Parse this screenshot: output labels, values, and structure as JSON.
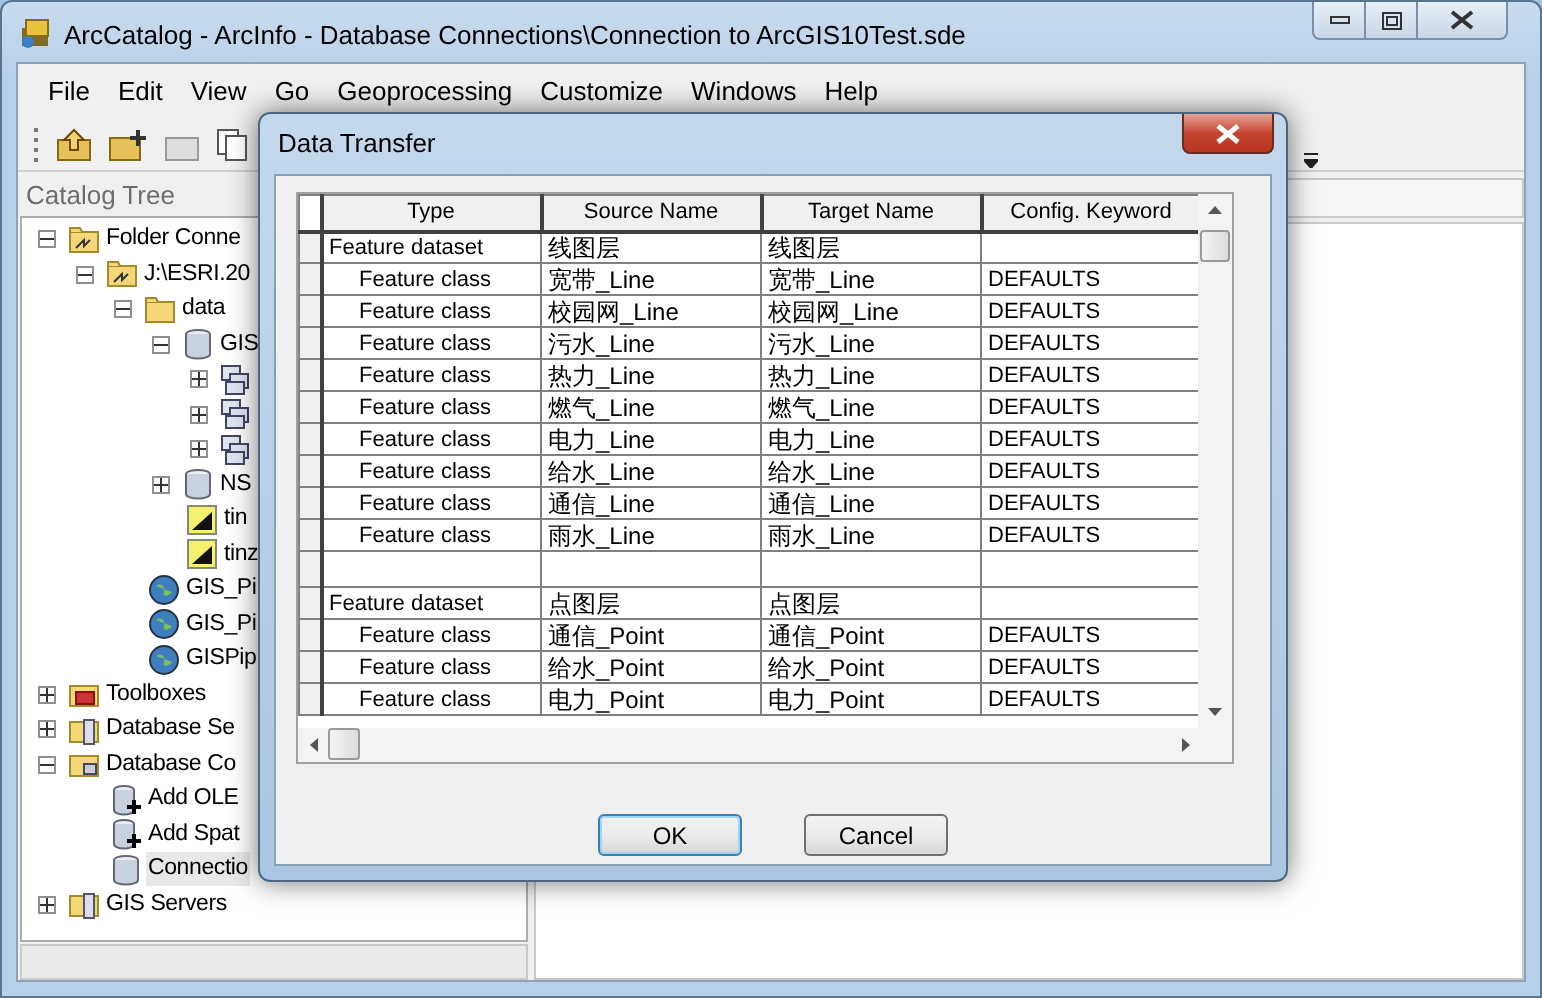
{
  "window": {
    "title": "ArcCatalog - ArcInfo - Database Connections\\Connection to ArcGIS10Test.sde"
  },
  "menu": [
    "File",
    "Edit",
    "View",
    "Go",
    "Geoprocessing",
    "Customize",
    "Windows",
    "Help"
  ],
  "catalog_tree": {
    "title": "Catalog Tree",
    "items": [
      {
        "label": "Folder Conne",
        "kind": "connection",
        "expanded": true,
        "selected": false,
        "children": [
          {
            "label": "J:\\ESRI.20",
            "kind": "connection",
            "expanded": true,
            "selected": false,
            "children": [
              {
                "label": "data",
                "kind": "folder",
                "expanded": true,
                "selected": false,
                "children": [
                  {
                    "label": "GIS",
                    "kind": "database",
                    "expanded": true,
                    "selected": false,
                    "children": [
                      {
                        "kind": "dataset",
                        "expanded": false
                      },
                      {
                        "kind": "dataset",
                        "expanded": false
                      },
                      {
                        "kind": "dataset",
                        "expanded": false
                      }
                    ]
                  },
                  {
                    "label": "NS",
                    "kind": "database",
                    "expanded": false,
                    "selected": false
                  },
                  {
                    "label": "tin",
                    "kind": "tin",
                    "selected": false
                  },
                  {
                    "label": "tinz",
                    "kind": "tin",
                    "selected": false
                  }
                ]
              },
              {
                "label": "GIS_Pi",
                "kind": "map",
                "selected": false
              },
              {
                "label": "GIS_Pi",
                "kind": "map",
                "selected": false
              },
              {
                "label": "GISPip",
                "kind": "map",
                "selected": false
              }
            ]
          }
        ]
      },
      {
        "label": "Toolboxes",
        "kind": "toolbox",
        "expanded": false,
        "selected": false
      },
      {
        "label": "Database Se",
        "kind": "servers",
        "expanded": false,
        "selected": false
      },
      {
        "label": "Database Co",
        "kind": "dbfolder",
        "expanded": true,
        "selected": false,
        "children": [
          {
            "label": "Add OLE",
            "kind": "adder",
            "selected": false
          },
          {
            "label": "Add Spat",
            "kind": "adder",
            "selected": false
          },
          {
            "label": "Connectio",
            "kind": "database",
            "selected": true
          }
        ]
      },
      {
        "label": "GIS Servers",
        "kind": "servers",
        "expanded": false,
        "selected": false
      }
    ]
  },
  "dialog": {
    "title": "Data Transfer",
    "table": {
      "columns": [
        "Type",
        "Source Name",
        "Target Name",
        "Config. Keyword"
      ],
      "rows": [
        {
          "kind": "dataset",
          "type": "Feature dataset",
          "source": "线图层",
          "target": "线图层"
        },
        {
          "kind": "class",
          "type": "Feature class",
          "source": "宽带_Line",
          "target": "宽带_Line",
          "keyword": "DEFAULTS"
        },
        {
          "kind": "class",
          "type": "Feature class",
          "source": "校园网_Line",
          "target": "校园网_Line",
          "keyword": "DEFAULTS"
        },
        {
          "kind": "class",
          "type": "Feature class",
          "source": "污水_Line",
          "target": "污水_Line",
          "keyword": "DEFAULTS"
        },
        {
          "kind": "class",
          "type": "Feature class",
          "source": "热力_Line",
          "target": "热力_Line",
          "keyword": "DEFAULTS"
        },
        {
          "kind": "class",
          "type": "Feature class",
          "source": "燃气_Line",
          "target": "燃气_Line",
          "keyword": "DEFAULTS"
        },
        {
          "kind": "class",
          "type": "Feature class",
          "source": "电力_Line",
          "target": "电力_Line",
          "keyword": "DEFAULTS"
        },
        {
          "kind": "class",
          "type": "Feature class",
          "source": "给水_Line",
          "target": "给水_Line",
          "keyword": "DEFAULTS"
        },
        {
          "kind": "class",
          "type": "Feature class",
          "source": "通信_Line",
          "target": "通信_Line",
          "keyword": "DEFAULTS"
        },
        {
          "kind": "class",
          "type": "Feature class",
          "source": "雨水_Line",
          "target": "雨水_Line",
          "keyword": "DEFAULTS"
        },
        {
          "kind": "blank"
        },
        {
          "kind": "dataset",
          "type": "Feature dataset",
          "source": "点图层",
          "target": "点图层"
        },
        {
          "kind": "class",
          "type": "Feature class",
          "source": "通信_Point",
          "target": "通信_Point",
          "keyword": "DEFAULTS"
        },
        {
          "kind": "class",
          "type": "Feature class",
          "source": "给水_Point",
          "target": "给水_Point",
          "keyword": "DEFAULTS"
        },
        {
          "kind": "class",
          "type": "Feature class",
          "source": "电力_Point",
          "target": "电力_Point",
          "keyword": "DEFAULTS"
        }
      ]
    },
    "buttons": [
      {
        "label": "OK",
        "default": true
      },
      {
        "label": "Cancel",
        "default": false
      }
    ]
  }
}
